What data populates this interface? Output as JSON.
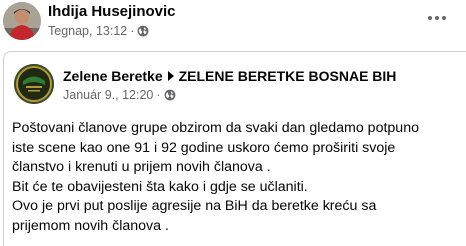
{
  "post": {
    "author": "Ihdija Husejinovic",
    "timestamp": "Tegnap, 13:12",
    "separator": "·",
    "privacy_icon": "globe-icon",
    "more_icon": "more-options-icon"
  },
  "shared_post": {
    "page_name": "Zelene Beretke",
    "group_name": "ZELENE BERETKE BOSNAE BIH",
    "arrow_icon": "triangle-right-icon",
    "timestamp": "Január 9., 12:20",
    "separator": "·",
    "privacy_icon": "globe-icon",
    "text_lines": [
      "Poštovani članove grupe obzirom da svaki dan gledamo potpuno",
      "iste scene kao one 91 i 92 godine uskoro ćemo proširiti svoje",
      "članstvo i krenuti u prijem novih članova .",
      "Bit će te obavijesteni šta kako i gdje se učlaniti.",
      "Ovo je prvi put poslije agresije na BiH da beretke kreću sa",
      "prijemom novih članova ."
    ]
  },
  "colors": {
    "text_primary": "#050505",
    "text_secondary": "#65676b",
    "card_border": "#ced0d4"
  }
}
